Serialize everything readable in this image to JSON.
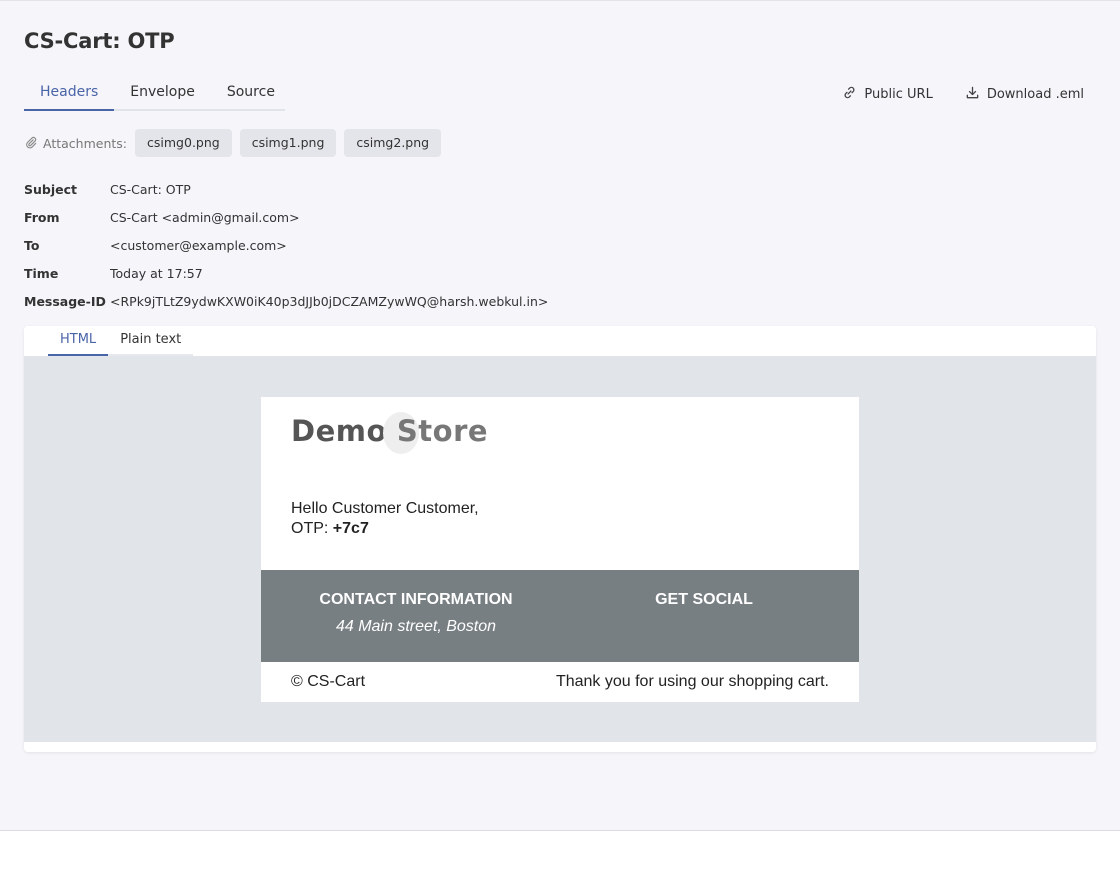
{
  "page": {
    "title": "CS-Cart: OTP"
  },
  "tabs": [
    {
      "label": "Headers",
      "active": true
    },
    {
      "label": "Envelope",
      "active": false
    },
    {
      "label": "Source",
      "active": false
    }
  ],
  "actions": {
    "public_url": {
      "label": "Public URL",
      "icon": "link-icon"
    },
    "download": {
      "label": "Download .eml",
      "icon": "download-icon"
    }
  },
  "attachments": {
    "label": "Attachments:",
    "icon": "paperclip-icon",
    "files": [
      "csimg0.png",
      "csimg1.png",
      "csimg2.png"
    ]
  },
  "headers": [
    {
      "key": "Subject",
      "value": "CS-Cart: OTP"
    },
    {
      "key": "From",
      "value": "CS-Cart <admin@gmail.com>"
    },
    {
      "key": "To",
      "value": "<customer@example.com>"
    },
    {
      "key": "Time",
      "value": "Today at 17:57"
    },
    {
      "key": "Message-ID",
      "value": "<RPk9jTLtZ9ydwKXW0iK40p3dJJb0jDCZAMZywWQ@harsh.webkul.in>"
    }
  ],
  "body_tabs": [
    {
      "label": "HTML",
      "active": true
    },
    {
      "label": "Plain text",
      "active": false
    }
  ],
  "email": {
    "logo": {
      "word1": "Demo",
      "word2": "Store"
    },
    "greeting": "Hello Customer Customer,",
    "otp_label": "OTP:",
    "otp_code": "+7c7",
    "contact_title": "CONTACT INFORMATION",
    "contact_address": "44 Main street, Boston",
    "social_title": "GET SOCIAL",
    "copyright": "© CS-Cart",
    "thanks": "Thank you for using our shopping cart."
  },
  "colors": {
    "accent": "#4a64a8",
    "footer_band": "#787f83",
    "preview_bg": "#e1e4e8",
    "page_bg": "#f5f5fa"
  }
}
